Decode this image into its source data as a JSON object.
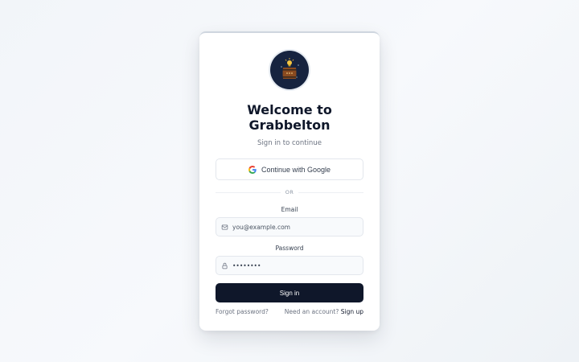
{
  "brand": {
    "title": "Welcome to Grabbelton",
    "subtitle": "Sign in to continue"
  },
  "google": {
    "label": "Continue with Google"
  },
  "divider": {
    "text": "OR"
  },
  "email": {
    "label": "Email",
    "placeholder": "you@example.com"
  },
  "password": {
    "label": "Password",
    "value": "********"
  },
  "signin": {
    "label": "Sign in"
  },
  "footer": {
    "forgot": "Forgot password?",
    "need_account": "Need an account?",
    "signup": "Sign up"
  },
  "colors": {
    "primary": "#0f172a",
    "logo_bg": "#16233f",
    "page_bg": "#f4f7fa"
  }
}
